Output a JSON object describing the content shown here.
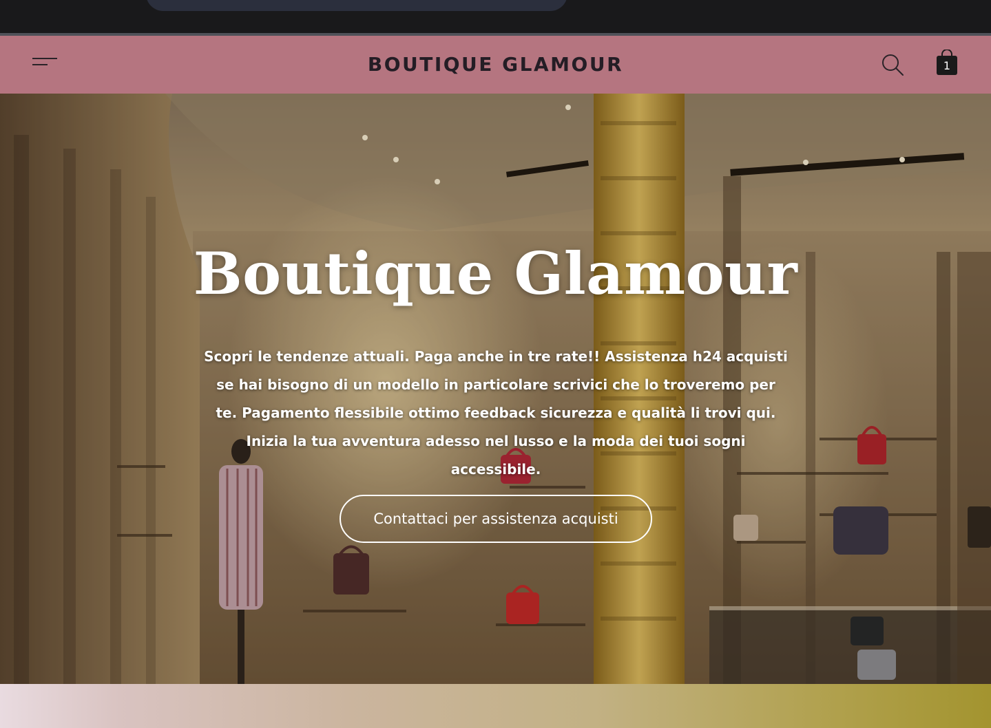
{
  "header": {
    "brand": "BOUTIQUE GLAMOUR",
    "menu_icon": "hamburger-menu-icon",
    "search_icon": "search-icon",
    "cart_icon": "shopping-bag-icon",
    "cart_count": "1",
    "background_color": "#b57580"
  },
  "hero": {
    "title": "Boutique Glamour",
    "description": "Scopri le tendenze attuali. Paga anche in tre rate!! Assistenza h24 acquisti\nse hai bisogno di un modello in particolare scrivici che lo troveremo per\nte. Pagamento flessibile ottimo feedback  sicurezza e qualità li trovi qui.\nInizia la tua avventura adesso nel lusso e la moda dei tuoi sogni accessibile.",
    "cta_label": "Contattaci per assistenza acquisti"
  }
}
